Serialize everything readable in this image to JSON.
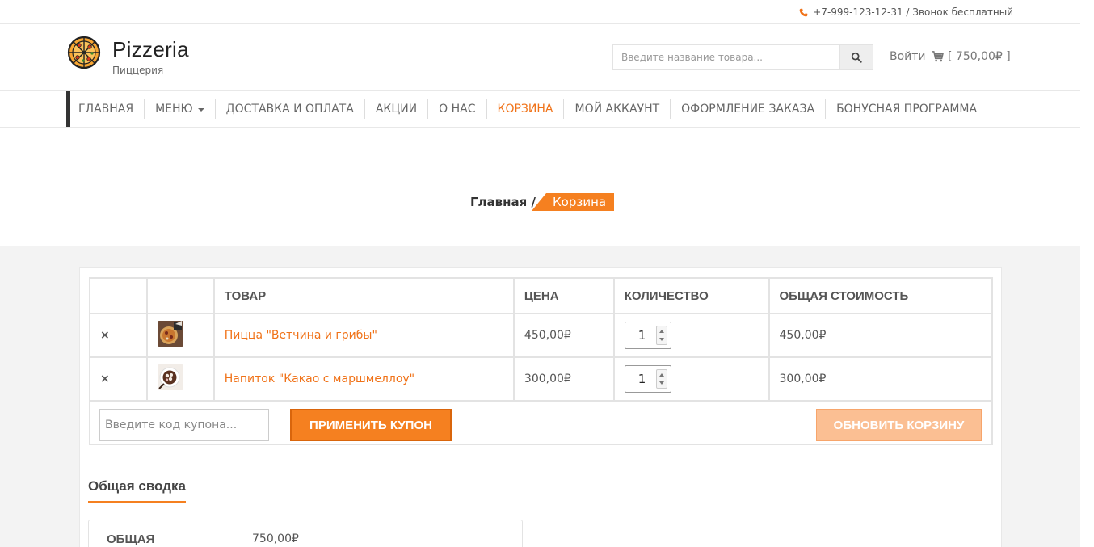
{
  "topbar": {
    "phone_text": "+7-999-123-12-31 / Звонок бесплатный"
  },
  "header": {
    "brand_name": "Pizzeria",
    "brand_sub": "Пиццерия",
    "search_placeholder": "Введите название товара...",
    "login_label": "Войти",
    "cart_label": "[ 750,00₽ ]"
  },
  "nav": {
    "items": [
      {
        "label": "ГЛАВНАЯ"
      },
      {
        "label": "МЕНЮ"
      },
      {
        "label": "ДОСТАВКА И ОПЛАТА"
      },
      {
        "label": "АКЦИИ"
      },
      {
        "label": "О НАС"
      },
      {
        "label": "КОРЗИНА"
      },
      {
        "label": "МОЙ АККАУНТ"
      },
      {
        "label": "ОФОРМЛЕНИЕ ЗАКАЗА"
      },
      {
        "label": "БОНУСНАЯ ПРОГРАММА"
      }
    ]
  },
  "breadcrumb": {
    "home": "Главная /",
    "current": "Корзина"
  },
  "cart": {
    "headers": {
      "product": "ТОВАР",
      "price": "ЦЕНА",
      "quantity": "КОЛИЧЕСТВО",
      "total": "ОБЩАЯ СТОИМОСТЬ"
    },
    "rows": [
      {
        "name": "Пицца \"Ветчина и грибы\"",
        "price": "450,00₽",
        "qty": "1",
        "total": "450,00₽"
      },
      {
        "name": "Напиток \"Какао с маршмеллоу\"",
        "price": "300,00₽",
        "qty": "1",
        "total": "300,00₽"
      }
    ],
    "coupon_placeholder": "Введите код купона...",
    "apply_label": "ПРИМЕНИТЬ КУПОН",
    "update_label": "ОБНОВИТЬ КОРЗИНУ",
    "remove_symbol": "×"
  },
  "summary": {
    "title": "Общая сводка",
    "total_label": "ОБЩАЯ",
    "total_value": "750,00₽"
  },
  "colors": {
    "accent": "#f58020",
    "remove": "#e0191c"
  }
}
